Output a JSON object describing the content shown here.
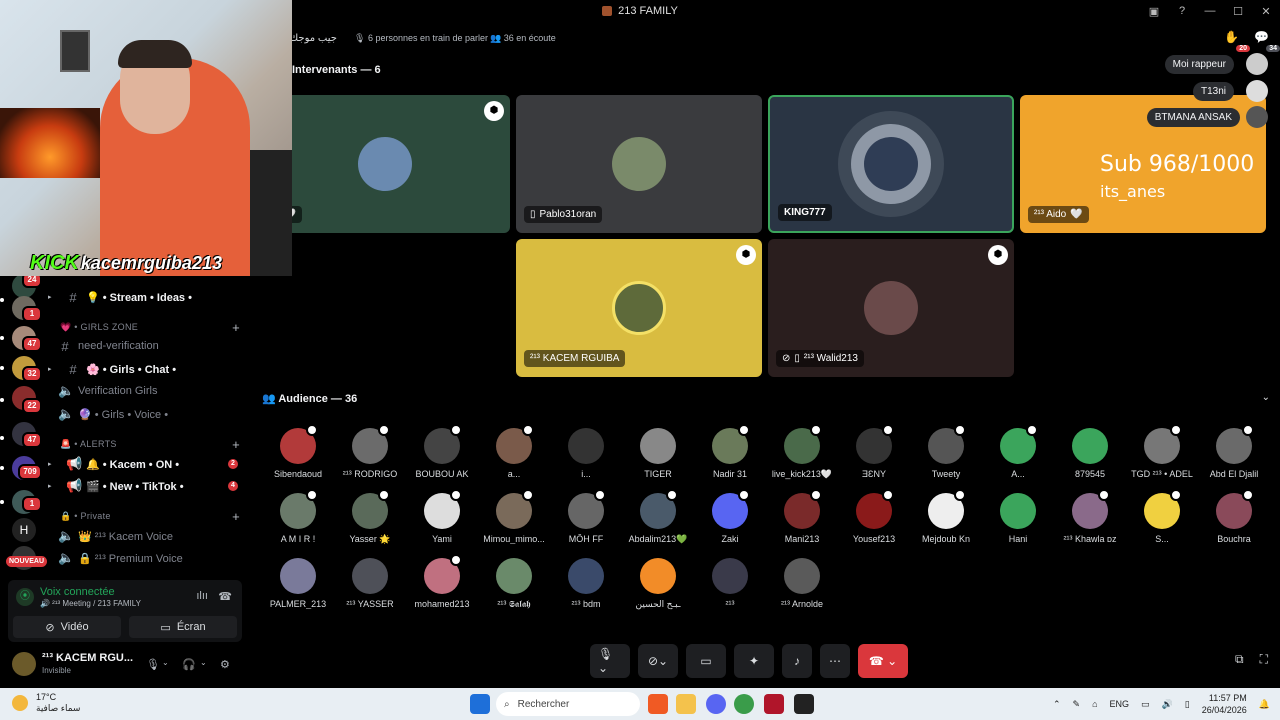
{
  "window": {
    "title": "213 FAMILY"
  },
  "topbar": {
    "channel_name": "جيب موجك",
    "speaking": "6 personnes en train de parler",
    "listening": "36 en écoute",
    "raise_badge": "20",
    "members_badge": "34"
  },
  "stage": {
    "speakers_label": "Intervenants — 6",
    "tiles": [
      {
        "name": "d",
        "color": "#2c4a3c",
        "has_shield": true
      },
      {
        "name": "Pablo31oran",
        "color": "#3a3b3e",
        "has_shield": false
      },
      {
        "name": "KING777",
        "color": "#2a3544",
        "has_shield": false
      },
      {
        "name": "²¹³ Aido",
        "color": "#f0a42c",
        "has_shield": false
      },
      {
        "name": "²¹³ KACEM RGUIBA",
        "color": "#d9bc40",
        "has_shield": true
      },
      {
        "name": "²¹³ Walid213",
        "color": "#2a1e1e",
        "has_shield": true
      }
    ],
    "sub_counter": "Sub 968/1000",
    "sub_user": "its_anes",
    "pills": [
      "Moi rappeur",
      "T13ni",
      "BTMANA ANSAK"
    ]
  },
  "audience": {
    "label": "Audience — 36",
    "members": [
      "Sibendaoud",
      "²¹³ RODRIGO",
      "BOUBOU AK",
      "a...",
      "i...",
      "TIGER",
      "Nadir 31",
      "live_kick213🤍",
      "ƎƐNY",
      "Tweety",
      "A...",
      "879545",
      "TGD ²¹³ • ADEL",
      "Abd El Djalil",
      "A M I R !",
      "Yasser 🌟",
      "Yami",
      "Mimou_mimo...",
      "MÔH FF",
      "Abdalim213💚",
      "Zaki",
      "Mani213",
      "Yousef213",
      "Mejdoub Kn",
      "Hani",
      "²¹³ Khawla ᴅz",
      "S...",
      "Bouchra",
      "PALMER_213",
      "²¹³ YASSER",
      "mohamed213",
      "²¹³ 𝕾𝖆𝖑𝖆𝖍",
      "²¹³ bdm",
      "ـبـح الحسين",
      "²¹³",
      "²¹³ Arnolde"
    ]
  },
  "sidebar": {
    "channels": [
      {
        "label": "💡 • Stream • Ideas •",
        "type": "text",
        "bold": true
      },
      {
        "category": "💗 • GIRLS ZONE"
      },
      {
        "label": "need-verification",
        "type": "text",
        "bold": false
      },
      {
        "label": "🌸 • Girls • Chat •",
        "type": "text",
        "bold": true
      },
      {
        "label": "Verification Girls",
        "type": "voice",
        "bold": false
      },
      {
        "label": "🔮 • Girls • Voice •",
        "type": "voice",
        "bold": false
      },
      {
        "category": "🚨 • ALERTS"
      },
      {
        "label": "🔔 • Kacem • ON •",
        "type": "announce",
        "bold": true,
        "badge": "2"
      },
      {
        "label": "🎬 • New • TikTok •",
        "type": "announce",
        "bold": true,
        "badge": "4"
      },
      {
        "category": "🔒 • Private"
      },
      {
        "label": "👑 ²¹³ Kacem Voice",
        "type": "voice",
        "bold": false
      },
      {
        "label": "🔒 ²¹³ Premium Voice",
        "type": "voice",
        "bold": false
      }
    ],
    "server_badges": [
      "24",
      "1",
      "47",
      "32",
      "22",
      "47",
      "709",
      "1"
    ],
    "nouveau": "NOUVEAU"
  },
  "voice": {
    "status": "Voix connectée",
    "sub": "🔊 ²¹³ Meeting / 213 FAMILY",
    "video_label": "Vidéo",
    "screen_label": "Écran"
  },
  "user": {
    "name": "²¹³ KACEM RGU...",
    "status": "Invisible"
  },
  "webcam": {
    "brand": "KICK",
    "handle": "kacemrguiba213"
  },
  "taskbar": {
    "temp": "17°C",
    "weather": "سماء صافية",
    "search_placeholder": "Rechercher",
    "lang": "ENG",
    "time": "11:57 PM",
    "date": "26/04/2026"
  }
}
